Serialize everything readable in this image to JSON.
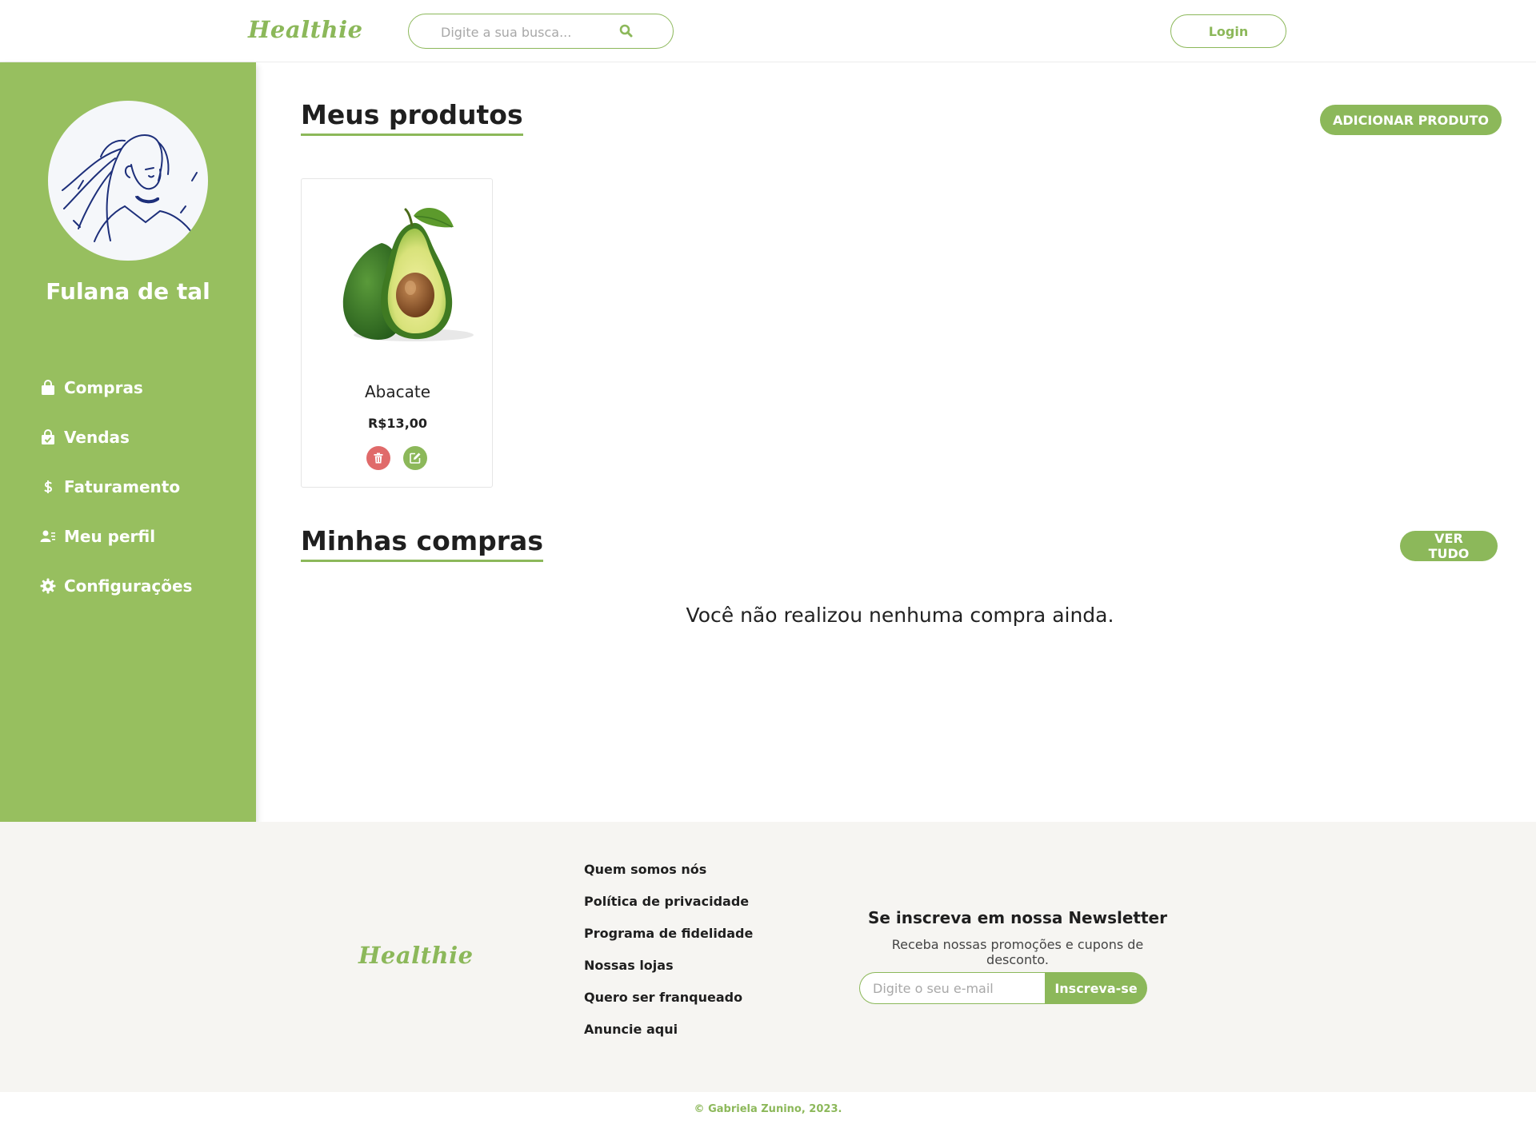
{
  "header": {
    "logo": "Healthie",
    "search_placeholder": "Digite a sua busca...",
    "login_label": "Login"
  },
  "sidebar": {
    "user_name": "Fulana de tal",
    "items": [
      {
        "label": "Compras",
        "icon": "shopping-bag-icon"
      },
      {
        "label": "Vendas",
        "icon": "bag-check-icon"
      },
      {
        "label": "Faturamento",
        "icon": "dollar-icon"
      },
      {
        "label": "Meu perfil",
        "icon": "user-list-icon"
      },
      {
        "label": "Configurações",
        "icon": "gear-icon"
      }
    ]
  },
  "products": {
    "title": "Meus produtos",
    "add_button": "ADICIONAR PRODUTO",
    "items": [
      {
        "name": "Abacate",
        "price": "R$13,00"
      }
    ]
  },
  "purchases": {
    "title": "Minhas compras",
    "view_all_button": "VER TUDO",
    "empty_message": "Você não realizou nenhuma compra ainda."
  },
  "footer": {
    "logo": "Healthie",
    "links": [
      "Quem somos nós",
      "Política de privacidade",
      "Programa de fidelidade",
      "Nossas lojas",
      "Quero ser franqueado",
      "Anuncie aqui"
    ],
    "newsletter": {
      "title": "Se inscreva em nossa Newsletter",
      "subtitle": "Receba nossas promoções e cupons de desconto.",
      "email_placeholder": "Digite o seu e-mail",
      "subscribe_label": "Inscreva-se"
    },
    "copyright": "© Gabriela Zunino, 2023."
  },
  "colors": {
    "brand_green": "#8cb85a",
    "sidebar_green": "#97bf5f",
    "delete_red": "#e06a6a"
  }
}
